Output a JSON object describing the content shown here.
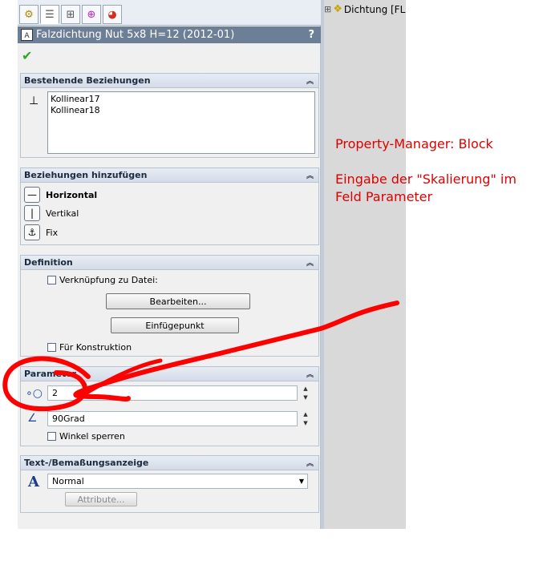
{
  "title": "Falzdichtung Nut 5x8 H=12 (2012-01)",
  "help": "?",
  "tree_node": "Dichtung [FL",
  "tree_expander": "⊞",
  "tabs": [
    "feature-manager",
    "property-manager",
    "configuration-manager",
    "dimxpert-manager",
    "display-manager"
  ],
  "groups": {
    "existing": {
      "header": "Bestehende Beziehungen",
      "items": [
        "Kollinear17",
        "Kollinear18"
      ]
    },
    "add": {
      "header": "Beziehungen hinzufügen",
      "items": [
        "Horizontal",
        "Vertikal",
        "Fix"
      ]
    },
    "definition": {
      "header": "Definition",
      "link_label": "Verknüpfung zu Datei:",
      "edit_button": "Bearbeiten...",
      "insert_button": "Einfügepunkt",
      "construction_label": "Für Konstruktion"
    },
    "parameter": {
      "header": "Parameter",
      "scale_value": "2",
      "angle_value": "90Grad",
      "lock_label": "Winkel sperren"
    },
    "text": {
      "header": "Text-/Bemaßungsanzeige",
      "font_select": "Normal",
      "attr_button": "Attribute..."
    }
  },
  "annotation": {
    "line1": "Property-Manager: Block",
    "line2": "Eingabe der \"Skalierung\" im",
    "line3": "Feld Parameter"
  },
  "colors": {
    "annotation": "#e00000",
    "titlebar": "#6d7f97",
    "ok": "#2ea52e"
  }
}
